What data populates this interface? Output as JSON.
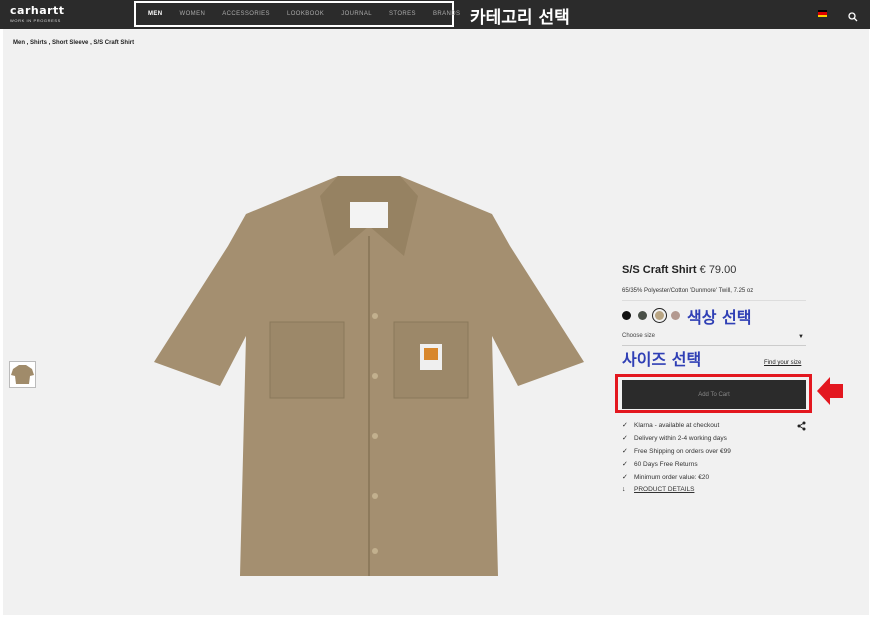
{
  "header": {
    "logo_text": "carhartt",
    "logo_tagline": "WORK IN PROGRESS",
    "nav": [
      "MEN",
      "WOMEN",
      "ACCESSORIES",
      "LOOKBOOK",
      "JOURNAL",
      "STORES",
      "BRANDS"
    ],
    "active_nav": "MEN",
    "annotation": "카테고리 선택",
    "flag": "germany-flag-icon",
    "search_icon": "search-icon"
  },
  "breadcrumb": [
    "Men",
    "Shirts",
    "Short Sleeve",
    "S/S Craft Shirt"
  ],
  "breadcrumb_sep": " , ",
  "product": {
    "name": "S/S Craft Shirt",
    "price": "€ 79.00",
    "material": "65/35% Polyester/Cotton 'Dunmore' Twill, 7.25 oz",
    "colors": [
      "#111111",
      "#4a5048",
      "#b9a583",
      "#b39990"
    ],
    "selected_color_index": 2,
    "color_annotation": "색상 선택",
    "size_placeholder": "Choose size",
    "size_annotation": "사이즈 선택",
    "find_size": "Find your size",
    "add_to_cart": "Add To Cart",
    "accent_color": "#e3171f",
    "features": [
      "Klarna - available at checkout",
      "Delivery within 2-4 working days",
      "Free Shipping on orders over €99",
      "60 Days Free Returns",
      "Minimum order value: €20"
    ],
    "details_link": "PRODUCT DETAILS"
  }
}
